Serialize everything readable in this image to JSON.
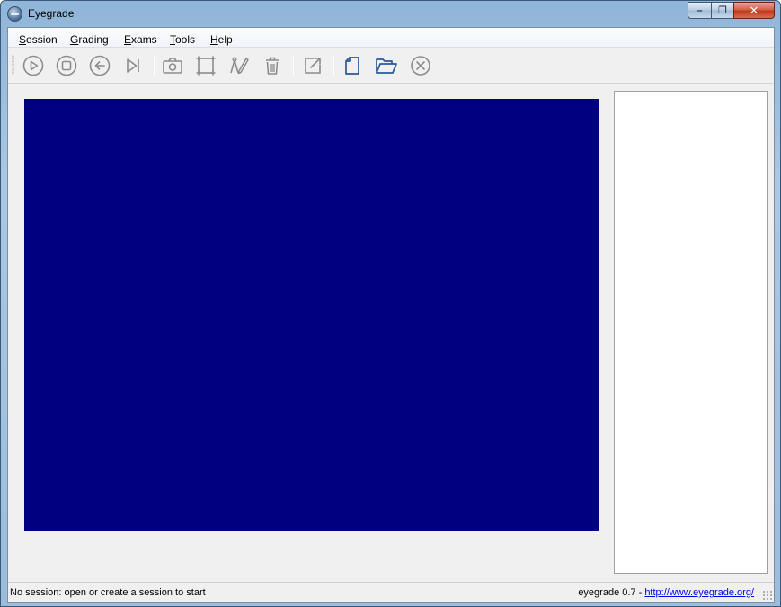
{
  "window": {
    "title": "Eyegrade",
    "minimize_label": "–",
    "maximize_label": "❐",
    "close_label": "✕"
  },
  "menubar": {
    "items": [
      {
        "label": "Session",
        "mnemonic": "S",
        "rest": "ession"
      },
      {
        "label": "Grading",
        "mnemonic": "G",
        "rest": "rading"
      },
      {
        "label": "Exams",
        "mnemonic": "E",
        "rest": "xams"
      },
      {
        "label": "Tools",
        "mnemonic": "T",
        "rest": "ools"
      },
      {
        "label": "Help",
        "mnemonic": "H",
        "rest": "elp"
      }
    ]
  },
  "toolbar": {
    "buttons": [
      {
        "icon": "play-icon"
      },
      {
        "icon": "stop-icon"
      },
      {
        "icon": "back-icon"
      },
      {
        "icon": "skip-next-icon"
      },
      {
        "icon": "camera-icon"
      },
      {
        "icon": "select-region-icon"
      },
      {
        "icon": "manual-detect-icon"
      },
      {
        "icon": "discard-icon"
      },
      {
        "icon": "export-icon"
      },
      {
        "icon": "new-session-icon"
      },
      {
        "icon": "open-session-icon"
      },
      {
        "icon": "close-session-icon"
      }
    ]
  },
  "image_panel": {
    "background": "#000080"
  },
  "statusbar": {
    "message": "No session: open or create a session to start",
    "version": "eyegrade 0.7 - ",
    "link": "http://www.eyegrade.org/"
  },
  "colors": {
    "icon_gray": "#8c8c8c",
    "icon_blue": "#2a5a9a",
    "camera_background": "#000080"
  }
}
